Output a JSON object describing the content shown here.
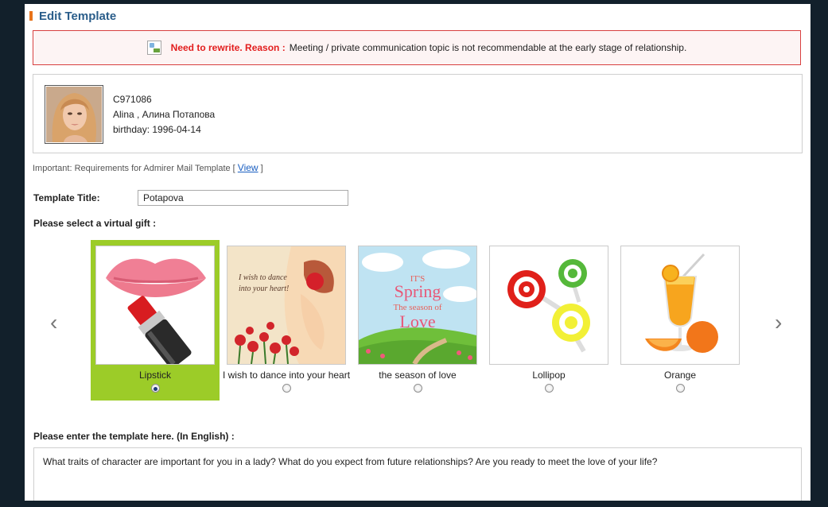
{
  "header": {
    "title": "Edit Template"
  },
  "alert": {
    "image_icon": "broken-image-icon",
    "label": "Need to rewrite. Reason :",
    "message": "Meeting / private communication topic is not recommendable at the early stage of relationship."
  },
  "profile": {
    "id": "C971086",
    "name": "Alina , Алина Потапова",
    "birthday": "birthday: 1996-04-14"
  },
  "important": {
    "text": "Important: Requirements for Admirer Mail Template [",
    "link": "View",
    "close": "]"
  },
  "form": {
    "template_title_label": "Template Title:",
    "template_title_value": "Potapova",
    "gift_label": "Please select a virtual gift :",
    "template_label": "Please enter the template here. (In English) :",
    "template_text": "What traits of character are important for you in a lady? What do you expect from future relationships? Are you ready to meet the love of your life?"
  },
  "carousel": {
    "prev": "‹",
    "next": "›",
    "gifts": [
      {
        "label": "Lipstick",
        "selected": true
      },
      {
        "label": "I wish to dance into your heart",
        "selected": false,
        "art_text": [
          "I wish to dance",
          "into your heart!"
        ]
      },
      {
        "label": "the season of love",
        "selected": false,
        "art_text": [
          "IT'S",
          "Spring",
          "The season of",
          "Love"
        ]
      },
      {
        "label": "Lollipop",
        "selected": false
      },
      {
        "label": "Orange",
        "selected": false
      }
    ]
  },
  "colors": {
    "accent_orange": "#e8731a",
    "title_blue": "#2a5d8a",
    "alert_red": "#e21d1d",
    "selected_green": "#9ccc28",
    "link_blue": "#1a5fc1"
  }
}
